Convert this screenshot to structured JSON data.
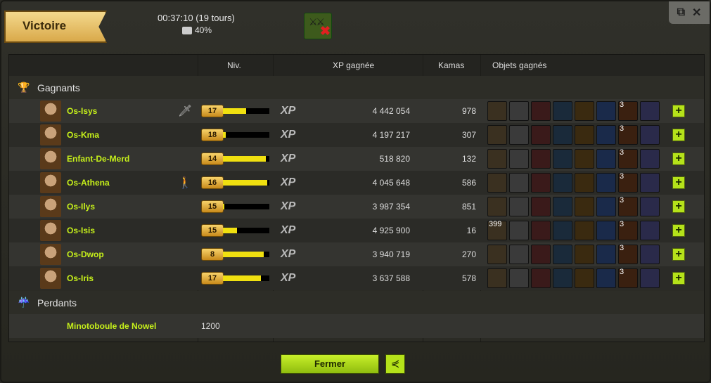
{
  "header": {
    "title": "Victoire",
    "duration": "00:37:10 (19 tours)",
    "bonus": "40%"
  },
  "columns": {
    "level": "Niv.",
    "xp": "XP gagnée",
    "kamas": "Kamas",
    "items": "Objets gagnés"
  },
  "sections": {
    "winners": "Gagnants",
    "losers": "Perdants"
  },
  "xp_label": "XP",
  "winners": [
    {
      "name": "Os-Isys",
      "level": "17",
      "progress": 0.5,
      "xp": "4 442 054",
      "kamas": "978",
      "role": "sword"
    },
    {
      "name": "Os-Kma",
      "level": "18",
      "progress": 0.06,
      "xp": "4 197 217",
      "kamas": "307",
      "role": ""
    },
    {
      "name": "Enfant-De-Merd",
      "level": "14",
      "progress": 0.92,
      "xp": "518 820",
      "kamas": "132",
      "role": ""
    },
    {
      "name": "Os-Athena",
      "level": "16",
      "progress": 0.95,
      "xp": "4 045 648",
      "kamas": "586",
      "role": "person"
    },
    {
      "name": "Os-Ilys",
      "level": "15",
      "progress": 0.03,
      "xp": "3 987 354",
      "kamas": "851",
      "role": ""
    },
    {
      "name": "Os-Isis",
      "level": "15",
      "progress": 0.3,
      "xp": "4 925 900",
      "kamas": "16",
      "role": ""
    },
    {
      "name": "Os-Dwop",
      "level": "8",
      "progress": 0.88,
      "xp": "3 940 719",
      "kamas": "270",
      "role": ""
    },
    {
      "name": "Os-Iris",
      "level": "17",
      "progress": 0.82,
      "xp": "3 637 588",
      "kamas": "578",
      "role": ""
    }
  ],
  "item_quantities": {
    "gift": "3",
    "isis_first": "399"
  },
  "loser": {
    "name": "Minotoboule de Nowel",
    "level": "1200"
  },
  "buttons": {
    "close": "Fermer"
  }
}
